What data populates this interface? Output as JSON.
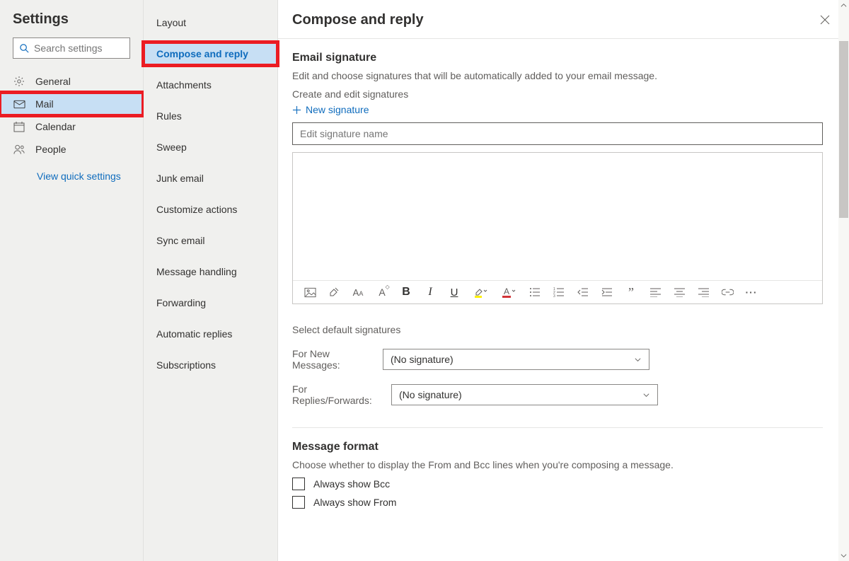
{
  "settings_title": "Settings",
  "search_placeholder": "Search settings",
  "quick_link": "View quick settings",
  "nav": [
    {
      "id": "general",
      "label": "General",
      "icon": "gear-icon",
      "selected": false,
      "hl": false
    },
    {
      "id": "mail",
      "label": "Mail",
      "icon": "mail-icon",
      "selected": true,
      "hl": true
    },
    {
      "id": "calendar",
      "label": "Calendar",
      "icon": "calendar-icon",
      "selected": false,
      "hl": false
    },
    {
      "id": "people",
      "label": "People",
      "icon": "people-icon",
      "selected": false,
      "hl": false
    }
  ],
  "subnav": [
    {
      "id": "layout",
      "label": "Layout",
      "selected": false,
      "hl": false
    },
    {
      "id": "compose-reply",
      "label": "Compose and reply",
      "selected": true,
      "hl": true
    },
    {
      "id": "attachments",
      "label": "Attachments",
      "selected": false,
      "hl": false
    },
    {
      "id": "rules",
      "label": "Rules",
      "selected": false,
      "hl": false
    },
    {
      "id": "sweep",
      "label": "Sweep",
      "selected": false,
      "hl": false
    },
    {
      "id": "junk",
      "label": "Junk email",
      "selected": false,
      "hl": false
    },
    {
      "id": "customize",
      "label": "Customize actions",
      "selected": false,
      "hl": false
    },
    {
      "id": "sync",
      "label": "Sync email",
      "selected": false,
      "hl": false
    },
    {
      "id": "msg-handle",
      "label": "Message handling",
      "selected": false,
      "hl": false
    },
    {
      "id": "forwarding",
      "label": "Forwarding",
      "selected": false,
      "hl": false
    },
    {
      "id": "auto-replies",
      "label": "Automatic replies",
      "selected": false,
      "hl": false
    },
    {
      "id": "subs",
      "label": "Subscriptions",
      "selected": false,
      "hl": false
    }
  ],
  "panel": {
    "title": "Compose and reply",
    "sig_heading": "Email signature",
    "sig_desc": "Edit and choose signatures that will be automatically added to your email message.",
    "create_desc": "Create and edit signatures",
    "new_sig": "New signature",
    "sig_name_placeholder": "Edit signature name",
    "select_def": "Select default signatures",
    "for_new": "For New Messages:",
    "for_replies": "For Replies/Forwards:",
    "no_sig": "(No signature)",
    "msg_format_h": "Message format",
    "msg_format_desc": "Choose whether to display the From and Bcc lines when you're composing a message.",
    "bcc_label": "Always show Bcc",
    "from_label": "Always show From"
  },
  "toolbar_icons": [
    "insert-image-icon",
    "format-painter-icon",
    "font-family-icon",
    "font-size-icon",
    "bold-icon",
    "italic-icon",
    "underline-icon",
    "highlight-icon",
    "font-color-icon",
    "bullets-icon",
    "numbering-icon",
    "outdent-icon",
    "indent-icon",
    "quote-icon",
    "align-left-icon",
    "align-center-icon",
    "align-right-icon",
    "link-icon",
    "more-icon"
  ]
}
